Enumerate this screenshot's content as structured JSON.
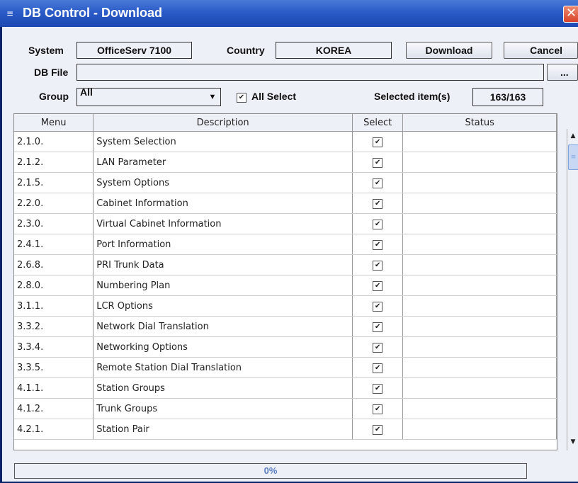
{
  "window": {
    "title": "DB Control - Download",
    "close": "✕",
    "app_icon": "≡"
  },
  "form": {
    "system_label": "System",
    "system_value": "OfficeServ 7100",
    "country_label": "Country",
    "country_value": "KOREA",
    "download_btn": "Download",
    "cancel_btn": "Cancel",
    "dbfile_label": "DB File",
    "dbfile_value": "",
    "browse_btn": "...",
    "group_label": "Group",
    "group_value": "All",
    "all_select_label": "All Select",
    "all_select_checked": true,
    "selected_items_label": "Selected item(s)",
    "selected_items_value": "163/163"
  },
  "table": {
    "columns": [
      "Menu",
      "Description",
      "Select",
      "Status"
    ],
    "rows": [
      {
        "menu": "2.1.0.",
        "desc": "System Selection",
        "select": true,
        "status": ""
      },
      {
        "menu": "2.1.2.",
        "desc": "LAN Parameter",
        "select": true,
        "status": ""
      },
      {
        "menu": "2.1.5.",
        "desc": "System Options",
        "select": true,
        "status": ""
      },
      {
        "menu": "2.2.0.",
        "desc": "Cabinet Information",
        "select": true,
        "status": ""
      },
      {
        "menu": "2.3.0.",
        "desc": "Virtual Cabinet Information",
        "select": true,
        "status": ""
      },
      {
        "menu": "2.4.1.",
        "desc": "Port Information",
        "select": true,
        "status": ""
      },
      {
        "menu": "2.6.8.",
        "desc": "PRI Trunk Data",
        "select": true,
        "status": ""
      },
      {
        "menu": "2.8.0.",
        "desc": "Numbering Plan",
        "select": true,
        "status": ""
      },
      {
        "menu": "3.1.1.",
        "desc": "LCR Options",
        "select": true,
        "status": ""
      },
      {
        "menu": "3.3.2.",
        "desc": "Network Dial Translation",
        "select": true,
        "status": ""
      },
      {
        "menu": "3.3.4.",
        "desc": "Networking Options",
        "select": true,
        "status": ""
      },
      {
        "menu": "3.3.5.",
        "desc": "Remote Station Dial Translation",
        "select": true,
        "status": ""
      },
      {
        "menu": "4.1.1.",
        "desc": "Station Groups",
        "select": true,
        "status": ""
      },
      {
        "menu": "4.1.2.",
        "desc": "Trunk Groups",
        "select": true,
        "status": ""
      },
      {
        "menu": "4.2.1.",
        "desc": "Station Pair",
        "select": true,
        "status": ""
      }
    ]
  },
  "progress": {
    "value": "0%"
  },
  "icons": {
    "check": "✔",
    "dropdown": "▼",
    "scroll_up": "▲",
    "scroll_down": "▼",
    "thumb": "≡"
  }
}
